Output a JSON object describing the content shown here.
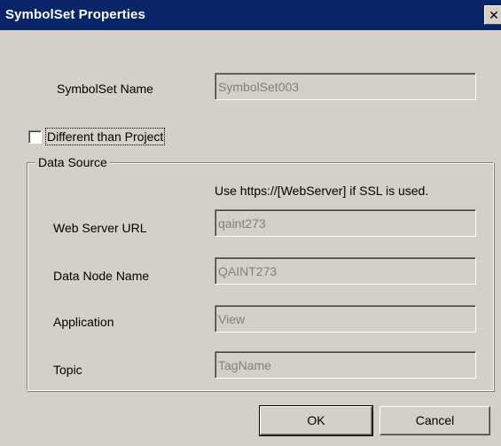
{
  "window": {
    "title": "SymbolSet Properties",
    "close_glyph": "✕"
  },
  "symbolset": {
    "name_label": "SymbolSet Name",
    "name_value": "SymbolSet003"
  },
  "checkbox": {
    "label": "Different than Project",
    "checked": false
  },
  "data_source": {
    "group_label": "Data Source",
    "ssl_hint": "Use https://[WebServer] if SSL is used.",
    "fields": [
      {
        "label": "Web Server URL",
        "value": "qaint273"
      },
      {
        "label": "Data Node Name",
        "value": "QAINT273"
      },
      {
        "label": "Application",
        "value": "View"
      },
      {
        "label": "Topic",
        "value": "TagName"
      }
    ]
  },
  "buttons": {
    "ok": "OK",
    "cancel": "Cancel"
  },
  "colors": {
    "titlebar": "#0a246a",
    "dialog_bg": "#d4d0c8",
    "disabled_text": "#808080"
  }
}
